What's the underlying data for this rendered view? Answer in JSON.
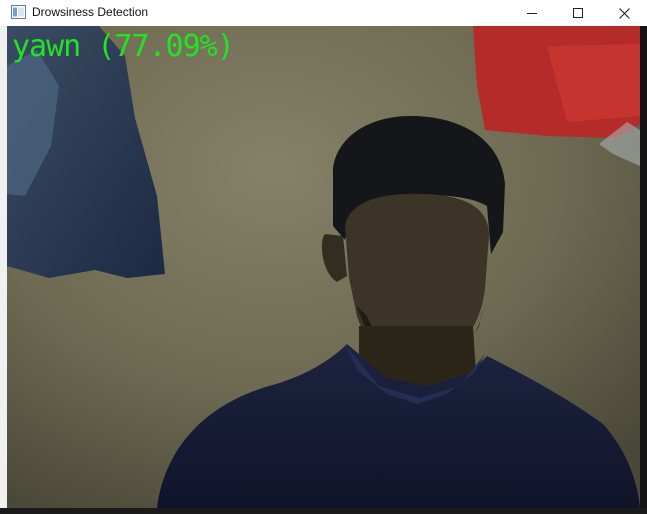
{
  "window": {
    "title": "Drowsiness Detection",
    "controls": {
      "minimize": "minimize-icon",
      "maximize": "maximize-icon",
      "close": "close-icon"
    }
  },
  "frame": {
    "overlay_text": "yawn (77.09%)",
    "overlay_color": "#22e322"
  },
  "colors": {
    "wall": "#7a745a",
    "shirt": "#141a33",
    "red_object": "#c4302c"
  }
}
